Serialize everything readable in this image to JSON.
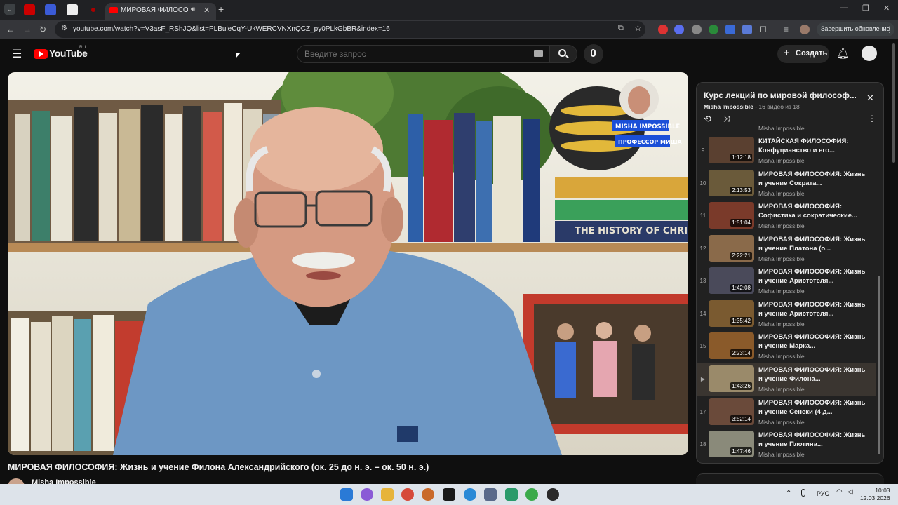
{
  "browser": {
    "active_tab_title": "МИРОВАЯ ФИЛОСОФИЯ: Ж",
    "url": "youtube.com/watch?v=V3asF_RShJQ&list=PLBuleCqY-UkWERCVNXnQCZ_py0PLkGbBR&index=16",
    "update_button": "Завершить обновление"
  },
  "header": {
    "logo_text": "YouTube",
    "region": "RU",
    "search_placeholder": "Введите запрос",
    "create_label": "Создать"
  },
  "overlay": {
    "channel_badge_line1": "MISHA IMPOSSIBLE",
    "channel_badge_line2": "ПРОФЕССОР МИША",
    "book_text": "THE HISTORY OF CHRISTIANITY"
  },
  "video": {
    "title": "МИРОВАЯ ФИЛОСОФИЯ: Жизнь и учение Филона Александрийского (ок. 25 до н. э. – ок. 50 н. э.)",
    "channel": "Misha Impossible"
  },
  "playlist": {
    "title": "Курс лекций по мировой философ...",
    "owner": "Misha Impossible",
    "position": "- 16 видео из 18",
    "partial_channel": "Misha Impossible",
    "items": [
      {
        "index": "9",
        "title": "КИТАЙСКАЯ ФИЛОСОФИЯ: Конфуцианство и его...",
        "channel": "Misha Impossible",
        "duration": "1:12:18",
        "color": "#5a4030"
      },
      {
        "index": "10",
        "title": "МИРОВАЯ ФИЛОСОФИЯ: Жизнь и учение Сократа...",
        "channel": "Misha Impossible",
        "duration": "2:13:53",
        "color": "#6a5a3a"
      },
      {
        "index": "11",
        "title": "МИРОВАЯ ФИЛОСОФИЯ: Софистика и сократические...",
        "channel": "Misha Impossible",
        "duration": "1:51:04",
        "color": "#7a3a2a"
      },
      {
        "index": "12",
        "title": "МИРОВАЯ ФИЛОСОФИЯ: Жизнь и учение Платона (о...",
        "channel": "Misha Impossible",
        "duration": "2:22:21",
        "color": "#8a6a4a"
      },
      {
        "index": "13",
        "title": "МИРОВАЯ ФИЛОСОФИЯ: Жизнь и учение Аристотеля...",
        "channel": "Misha Impossible",
        "duration": "1:42:08",
        "color": "#4a4a5a"
      },
      {
        "index": "14",
        "title": "МИРОВАЯ ФИЛОСОФИЯ: Жизнь и учение Аристотеля...",
        "channel": "Misha Impossible",
        "duration": "1:35:42",
        "color": "#7a5a30"
      },
      {
        "index": "15",
        "title": "МИРОВАЯ ФИЛОСОФИЯ: Жизнь и учение Марка...",
        "channel": "Misha Impossible",
        "duration": "2:23:14",
        "color": "#8a5a2a"
      },
      {
        "index": "▶",
        "title": "МИРОВАЯ ФИЛОСОФИЯ: Жизнь и учение Филона...",
        "channel": "Misha Impossible",
        "duration": "1:43:26",
        "color": "#9a8a6a"
      },
      {
        "index": "17",
        "title": "МИРОВАЯ ФИЛОСОФИЯ: Жизнь и учение Сенеки (4 д...",
        "channel": "Misha Impossible",
        "duration": "3:52:14",
        "color": "#6a4a3a"
      },
      {
        "index": "18",
        "title": "МИРОВАЯ ФИЛОСОФИЯ: Жизнь и учение Плотина...",
        "channel": "Misha Impossible",
        "duration": "1:47:46",
        "color": "#8a8a7a"
      }
    ]
  },
  "taskbar": {
    "lang": "РУС",
    "time": "10:03",
    "date": "12.03.2026"
  }
}
